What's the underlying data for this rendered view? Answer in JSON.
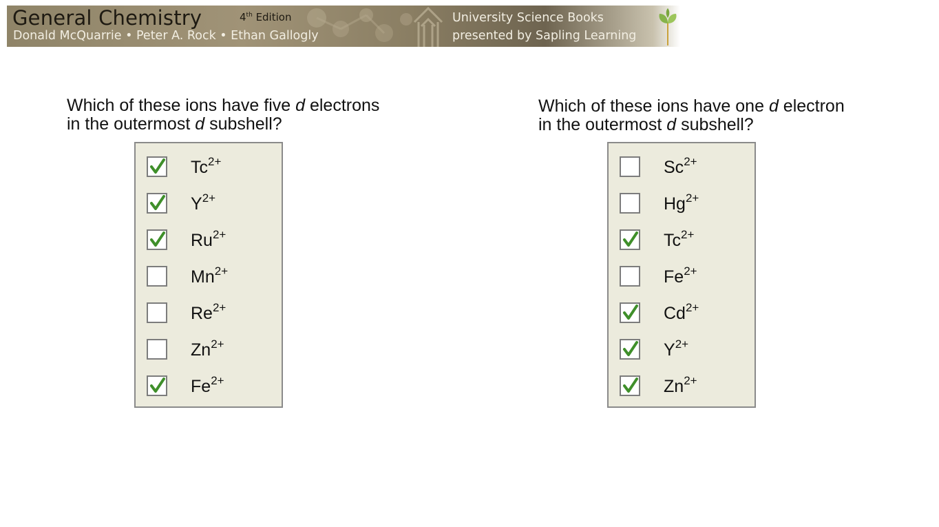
{
  "banner": {
    "title": "General Chemistry",
    "edition_number": "4",
    "edition_suffix": "th",
    "edition_word": "Edition",
    "authors": "Donald McQuarrie • Peter A. Rock • Ethan Gallogly",
    "publisher_line1": "University Science Books",
    "publisher_line2": "presented by Sapling Learning"
  },
  "questions": [
    {
      "prefix": "Which of these ions have five ",
      "italic": "d",
      "suffix": " electrons",
      "line2_prefix": "in the outermost ",
      "line2_italic": "d",
      "line2_suffix": " subshell?",
      "options": [
        {
          "symbol": "Tc",
          "charge": "2+",
          "checked": true
        },
        {
          "symbol": "Y",
          "charge": "2+",
          "checked": true
        },
        {
          "symbol": "Ru",
          "charge": "2+",
          "checked": true
        },
        {
          "symbol": "Mn",
          "charge": "2+",
          "checked": false
        },
        {
          "symbol": "Re",
          "charge": "2+",
          "checked": false
        },
        {
          "symbol": "Zn",
          "charge": "2+",
          "checked": false
        },
        {
          "symbol": "Fe",
          "charge": "2+",
          "checked": true
        }
      ]
    },
    {
      "prefix": "Which of these ions have one ",
      "italic": "d",
      "suffix": " electron",
      "line2_prefix": "in the outermost ",
      "line2_italic": "d",
      "line2_suffix": " subshell?",
      "options": [
        {
          "symbol": "Sc",
          "charge": "2+",
          "checked": false
        },
        {
          "symbol": "Hg",
          "charge": "2+",
          "checked": false
        },
        {
          "symbol": "Tc",
          "charge": "2+",
          "checked": true
        },
        {
          "symbol": "Fe",
          "charge": "2+",
          "checked": false
        },
        {
          "symbol": "Cd",
          "charge": "2+",
          "checked": true
        },
        {
          "symbol": "Y",
          "charge": "2+",
          "checked": true
        },
        {
          "symbol": "Zn",
          "charge": "2+",
          "checked": true
        }
      ]
    }
  ],
  "colors": {
    "checkmark": "#3f8f2a",
    "box_background": "#ecebdd",
    "banner_base": "#9a8e72"
  }
}
